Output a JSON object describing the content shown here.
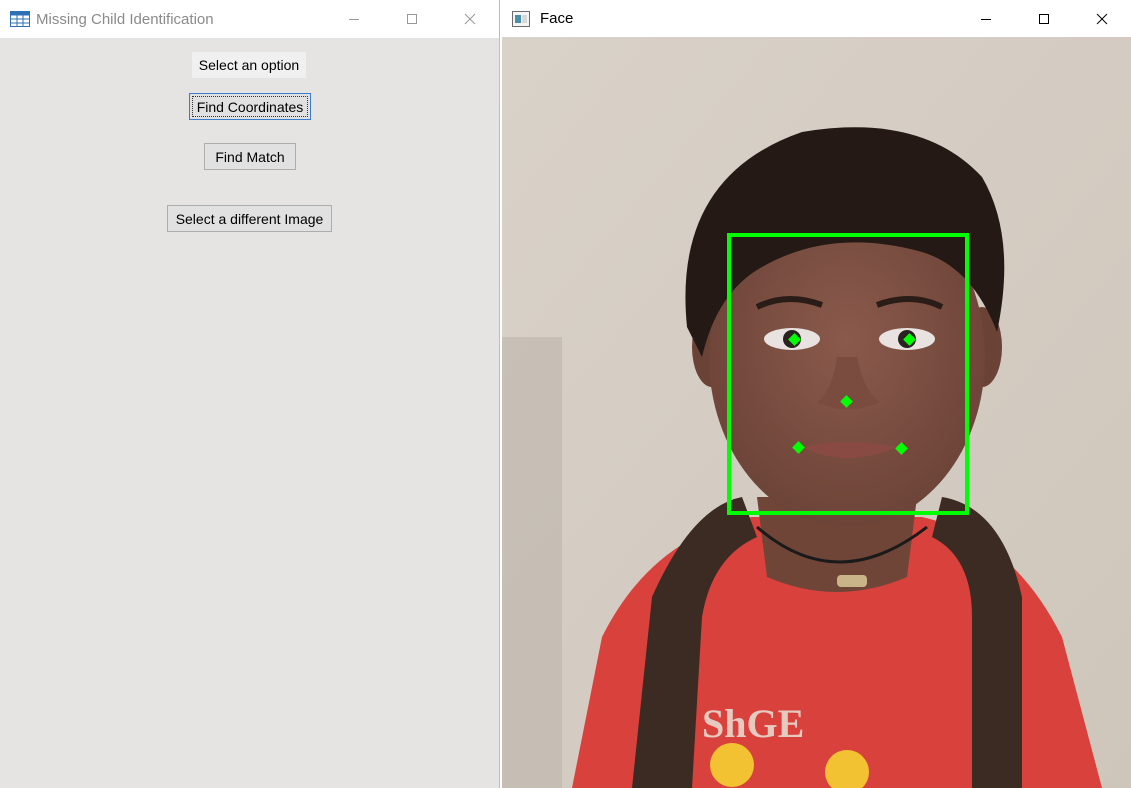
{
  "left_window": {
    "title": "Missing Child Identification",
    "icon": "table-grid-icon",
    "prompt_label": "Select an option",
    "buttons": {
      "find_coordinates": "Find Coordinates",
      "find_match": "Find Match",
      "select_image": "Select a different Image"
    }
  },
  "right_window": {
    "title": "Face",
    "icon": "image-window-icon",
    "image": {
      "subject": "child-face-photo",
      "overlay_color": "#00ff00",
      "landmarks": [
        "left-eye",
        "right-eye",
        "nose",
        "mouth-left",
        "mouth-right"
      ]
    }
  },
  "colors": {
    "window_bg": "#e6e4e2",
    "detection_box": "#00ff00",
    "focus_border": "#3b7ccc"
  }
}
